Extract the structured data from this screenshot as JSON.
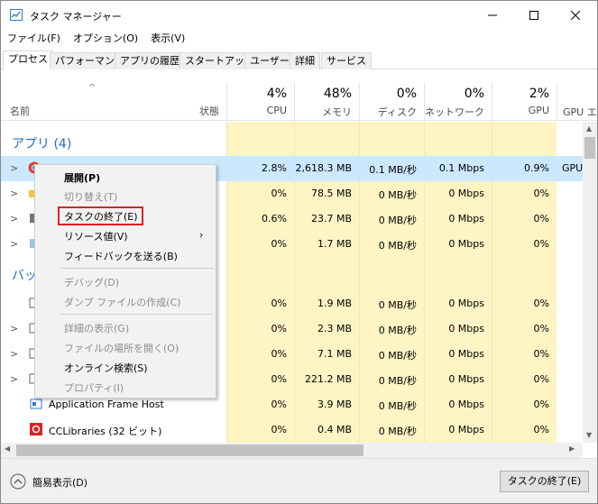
{
  "window": {
    "title": "タスク マネージャー",
    "minimize_icon": "minimize-icon",
    "maximize_icon": "maximize-icon",
    "close_icon": "close-icon"
  },
  "menu": [
    "ファイル(F)",
    "オプション(O)",
    "表示(V)"
  ],
  "tabs": [
    "プロセス",
    "パフォーマンス",
    "アプリの履歴",
    "スタートアップ",
    "ユーザー",
    "詳細",
    "サービス"
  ],
  "columns": {
    "name": "名前",
    "status": "状態",
    "cpu": {
      "pct": "4%",
      "label": "CPU"
    },
    "memory": {
      "pct": "48%",
      "label": "メモリ"
    },
    "disk": {
      "pct": "0%",
      "label": "ディスク"
    },
    "network": {
      "pct": "0%",
      "label": "ネットワーク"
    },
    "gpu": {
      "pct": "2%",
      "label": "GPU"
    },
    "gpu_engine": "GPU エ"
  },
  "groups": {
    "apps": "アプリ (4)",
    "background": "バッ"
  },
  "rows": [
    {
      "cpu": "2.8%",
      "mem": "2,618.3 MB",
      "disk": "0.1 MB/秒",
      "net": "0.1 Mbps",
      "gpu": "0.9%",
      "gpu_engine": "GPU"
    },
    {
      "cpu": "0%",
      "mem": "78.5 MB",
      "disk": "0 MB/秒",
      "net": "0 Mbps",
      "gpu": "0%"
    },
    {
      "cpu": "0.6%",
      "mem": "23.7 MB",
      "disk": "0 MB/秒",
      "net": "0 Mbps",
      "gpu": "0%"
    },
    {
      "cpu": "0%",
      "mem": "1.7 MB",
      "disk": "0 MB/秒",
      "net": "0 Mbps",
      "gpu": "0%"
    },
    {
      "cpu": "0%",
      "mem": "1.9 MB",
      "disk": "0 MB/秒",
      "net": "0 Mbps",
      "gpu": "0%"
    },
    {
      "cpu": "0%",
      "mem": "2.3 MB",
      "disk": "0 MB/秒",
      "net": "0 Mbps",
      "gpu": "0%"
    },
    {
      "cpu": "0%",
      "mem": "7.1 MB",
      "disk": "0 MB/秒",
      "net": "0 Mbps",
      "gpu": "0%"
    },
    {
      "cpu": "0%",
      "mem": "221.2 MB",
      "disk": "0 MB/秒",
      "net": "0 Mbps",
      "gpu": "0%"
    },
    {
      "name": "Application Frame Host",
      "cpu": "0%",
      "mem": "3.9 MB",
      "disk": "0 MB/秒",
      "net": "0 Mbps",
      "gpu": "0%"
    },
    {
      "name": "CCLibraries (32 ビット)",
      "cpu": "0%",
      "mem": "0.4 MB",
      "disk": "0 MB/秒",
      "net": "0 Mbps",
      "gpu": "0%"
    }
  ],
  "context_menu": {
    "expand": "展開(P)",
    "switch_to": "切り替え(T)",
    "end_task": "タスクの終了(E)",
    "resource_values": "リソース値(V)",
    "feedback": "フィードバックを送る(B)",
    "debug": "デバッグ(D)",
    "dump": "ダンプ ファイルの作成(C)",
    "details": "詳細の表示(G)",
    "open_location": "ファイルの場所を開く(O)",
    "search_online": "オンライン検索(S)",
    "properties": "プロパティ(I)"
  },
  "footer": {
    "fewer_details": "簡易表示(D)",
    "end_task_button": "タスクの終了(E)"
  },
  "colors": {
    "highlight_box": "#e02020",
    "group": "#1f6fc0",
    "heat": "#fff4c4",
    "selected": "#cce8ff"
  }
}
